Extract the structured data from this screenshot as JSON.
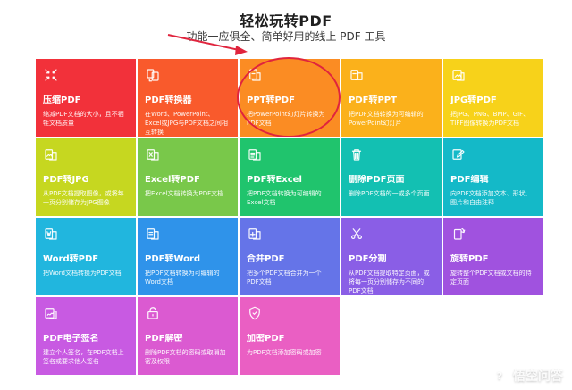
{
  "header": {
    "title": "轻松玩转PDF",
    "subtitle": "功能一应俱全、简单好用的线上 PDF 工具"
  },
  "tiles": [
    {
      "title": "压缩PDF",
      "description": "缩减PDF文档的大小，且不牺牲文档质量",
      "bg": "#f2313a",
      "icon": "compress-icon"
    },
    {
      "title": "PDF转换器",
      "description": "在Word、PowerPoint、Excel或JPG与PDF文档之间相互转换",
      "bg": "#f95a2c",
      "icon": "convert-icon"
    },
    {
      "title": "PPT转PDF",
      "description": "把PowerPoint幻灯片转换为PDF文档",
      "bg": "#fb8c23",
      "icon": "ppt-to-pdf-icon"
    },
    {
      "title": "PDF转PPT",
      "description": "把PDF文档转换为可编辑的PowerPoint幻灯片",
      "bg": "#fbb11b",
      "icon": "pdf-to-ppt-icon"
    },
    {
      "title": "JPG转PDF",
      "description": "把JPG、PNG、BMP、GIF、TIFF图像转换为PDF文档",
      "bg": "#f7d21a",
      "icon": "jpg-to-pdf-icon"
    },
    {
      "title": "PDF转JPG",
      "description": "从PDF文档提取图像，或将每一页分别储存为JPG图像",
      "bg": "#c6d720",
      "icon": "pdf-to-jpg-icon"
    },
    {
      "title": "Excel转PDF",
      "description": "把Excel文档转换为PDF文档",
      "bg": "#79c84a",
      "icon": "excel-to-pdf-icon"
    },
    {
      "title": "PDF转Excel",
      "description": "把PDF文档转换为可编辑的Excel文档",
      "bg": "#20c46d",
      "icon": "pdf-to-excel-icon"
    },
    {
      "title": "删除PDF页面",
      "description": "删除PDF文档的一或多个页面",
      "bg": "#13c0b2",
      "icon": "trash-icon"
    },
    {
      "title": "PDF编辑",
      "description": "向PDF文档添加文本、形状、图片和自由注释",
      "bg": "#14b9c8",
      "icon": "edit-icon"
    },
    {
      "title": "Word转PDF",
      "description": "把Word文档转换为PDF文档",
      "bg": "#21b6de",
      "icon": "word-to-pdf-icon"
    },
    {
      "title": "PDF转Word",
      "description": "把PDF文档转换为可编辑的Word文档",
      "bg": "#2f93ea",
      "icon": "pdf-to-word-icon"
    },
    {
      "title": "合并PDF",
      "description": "把多个PDF文档合并为一个PDF文档",
      "bg": "#6574e8",
      "icon": "merge-icon"
    },
    {
      "title": "PDF分割",
      "description": "从PDF文档提取特定页面，或将每一页分别储存为不同的PDF文档",
      "bg": "#8a5ee6",
      "icon": "scissors-icon"
    },
    {
      "title": "旋转PDF",
      "description": "旋转整个PDF文档或文档的特定页面",
      "bg": "#a052df",
      "icon": "rotate-icon"
    },
    {
      "title": "PDF电子签名",
      "description": "建立个人签名，在PDF文档上签名或要求他人签名",
      "bg": "#c85ae2",
      "icon": "sign-icon"
    },
    {
      "title": "PDF解密",
      "description": "删除PDF文档的密码或取消加密及权限",
      "bg": "#db5ad1",
      "icon": "unlock-icon"
    },
    {
      "title": "加密PDF",
      "description": "为PDF文档添加密码或加密",
      "bg": "#ea5fc3",
      "icon": "lock-icon"
    }
  ],
  "annotations": {
    "arrow_color": "#e0243d",
    "ellipse_color": "#e0243d"
  },
  "watermark": {
    "text": "悟空问答"
  }
}
